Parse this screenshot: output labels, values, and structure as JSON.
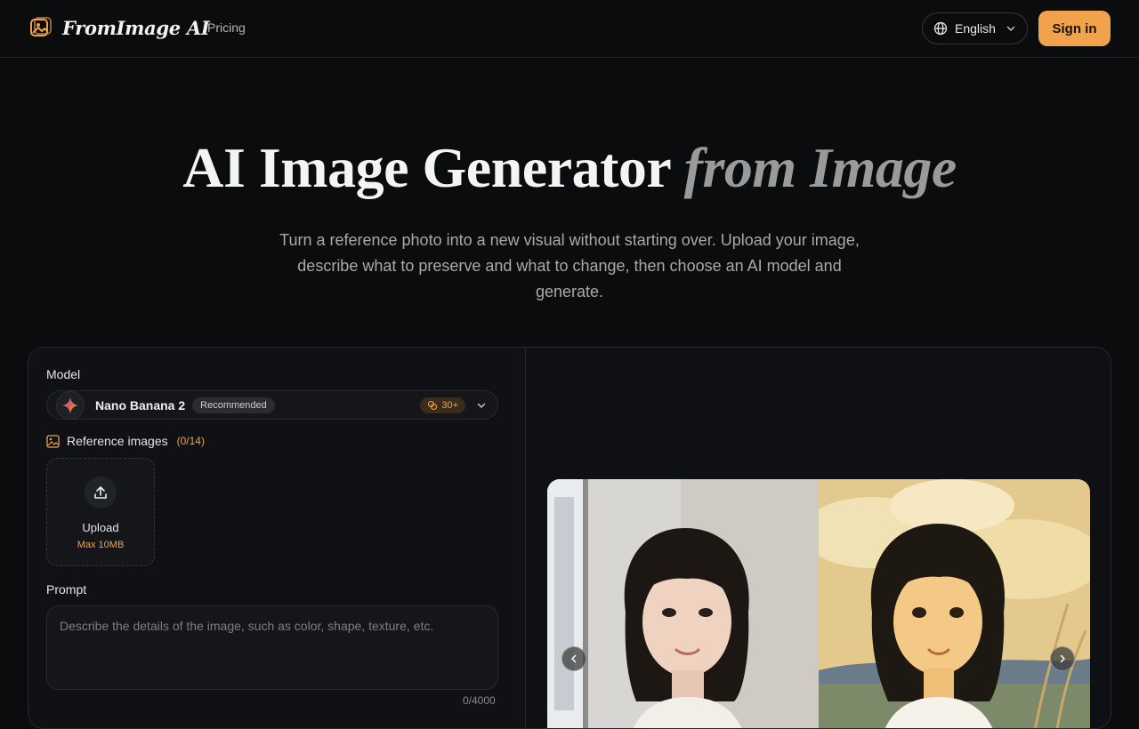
{
  "header": {
    "brand": "FromImage AI",
    "nav_pricing": "Pricing",
    "language": "English",
    "signin": "Sign in"
  },
  "hero": {
    "title_main": "AI Image Generator",
    "title_accent": "from Image",
    "subtitle": "Turn a reference photo into a new visual without starting over. Upload your image, describe what to preserve and what to change, then choose an AI model and generate."
  },
  "form": {
    "model_label": "Model",
    "model_name": "Nano Banana 2",
    "model_badge": "Recommended",
    "model_credits": "30+",
    "reference_label": "Reference images",
    "reference_count": "(0/14)",
    "upload_label": "Upload",
    "upload_max": "Max 10MB",
    "prompt_label": "Prompt",
    "prompt_placeholder": "Describe the details of the image, such as color, shape, texture, etc.",
    "char_count": "0/4000"
  },
  "icons": {
    "logo": "photo-frame-icon",
    "language": "globe-icon",
    "dropdown": "chevron-down-icon",
    "model": "sparkle-star-icon",
    "credits": "coins-icon",
    "reference": "image-icon",
    "upload": "upload-icon",
    "prev": "chevron-left-icon",
    "next": "chevron-right-icon"
  },
  "colors": {
    "accent": "#f0a34a",
    "background": "#0b0c0e",
    "panel": "#0f1114"
  }
}
